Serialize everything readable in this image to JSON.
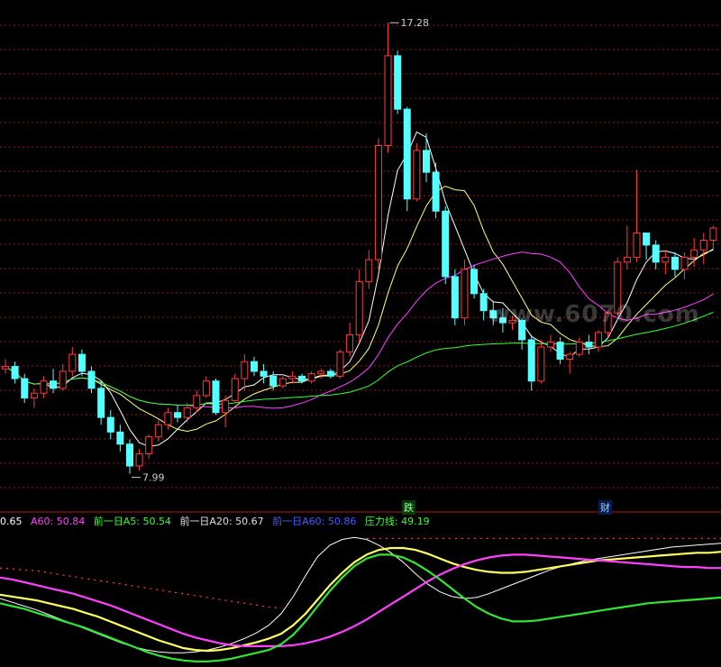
{
  "legend": {
    "a20_value": "0.65",
    "a60": "A60: 50.84",
    "prev_a5": "前一日A5: 50.54",
    "prev_a20": "前一日A20: 50.67",
    "prev_a60": "前一日A60: 50.86",
    "pressure": "压力线: 49.19"
  },
  "markers": {
    "die": "跌",
    "cai": "财"
  },
  "watermark": "www.6070.com",
  "colors": {
    "up": "#ff3b3b",
    "down": "#54ffff",
    "ma5": "#ffffff",
    "ma10": "#ffff80",
    "ma20": "#ff40ff",
    "ma60": "#33ff33",
    "grid": "#8a1a1a"
  },
  "chart_data": [
    {
      "type": "candlestick",
      "price_range": [
        7.5,
        17.6
      ],
      "annotations": [
        {
          "label": "17.28",
          "value": 17.28
        },
        {
          "label": "7.99",
          "value": 7.99
        }
      ],
      "candles": [
        [
          10.15,
          10.35,
          10.05,
          10.2
        ],
        [
          10.2,
          10.3,
          9.85,
          9.95
        ],
        [
          9.95,
          10.05,
          9.45,
          9.55
        ],
        [
          9.55,
          9.75,
          9.35,
          9.65
        ],
        [
          9.65,
          10.0,
          9.55,
          9.9
        ],
        [
          9.9,
          10.15,
          9.65,
          9.75
        ],
        [
          9.75,
          10.25,
          9.7,
          10.1
        ],
        [
          10.1,
          10.6,
          10.0,
          10.45
        ],
        [
          10.45,
          10.55,
          10.0,
          10.1
        ],
        [
          10.1,
          10.2,
          9.65,
          9.75
        ],
        [
          9.75,
          9.9,
          9.0,
          9.15
        ],
        [
          9.15,
          9.3,
          8.7,
          8.85
        ],
        [
          8.85,
          9.0,
          8.45,
          8.6
        ],
        [
          8.6,
          8.7,
          7.99,
          8.15
        ],
        [
          8.15,
          8.5,
          8.05,
          8.4
        ],
        [
          8.4,
          8.8,
          8.3,
          8.75
        ],
        [
          8.75,
          9.1,
          8.65,
          9.0
        ],
        [
          9.0,
          9.35,
          8.9,
          9.25
        ],
        [
          9.25,
          9.4,
          9.05,
          9.15
        ],
        [
          9.15,
          9.45,
          9.05,
          9.35
        ],
        [
          9.35,
          9.7,
          9.25,
          9.6
        ],
        [
          9.6,
          10.0,
          9.55,
          9.9
        ],
        [
          9.9,
          9.95,
          9.2,
          9.25
        ],
        [
          9.25,
          9.6,
          8.95,
          9.5
        ],
        [
          9.5,
          10.05,
          9.45,
          9.95
        ],
        [
          9.95,
          10.45,
          9.7,
          10.3
        ],
        [
          10.3,
          10.4,
          10.0,
          10.1
        ],
        [
          10.1,
          10.25,
          9.85,
          10.0
        ],
        [
          10.0,
          10.1,
          9.7,
          9.8
        ],
        [
          9.8,
          10.0,
          9.75,
          9.95
        ],
        [
          9.95,
          10.1,
          9.85,
          10.0
        ],
        [
          10.0,
          10.05,
          9.85,
          9.9
        ],
        [
          9.9,
          10.1,
          9.85,
          10.05
        ],
        [
          10.05,
          10.15,
          9.95,
          10.1
        ],
        [
          10.1,
          10.15,
          9.95,
          10.0
        ],
        [
          10.0,
          10.55,
          9.95,
          10.5
        ],
        [
          10.5,
          11.1,
          10.4,
          10.85
        ],
        [
          10.85,
          12.2,
          10.7,
          11.95
        ],
        [
          11.95,
          12.6,
          11.8,
          12.4
        ],
        [
          12.4,
          14.9,
          12.2,
          14.75
        ],
        [
          14.75,
          17.28,
          14.6,
          16.6
        ],
        [
          16.6,
          16.7,
          15.4,
          15.5
        ],
        [
          15.5,
          15.55,
          13.4,
          13.65
        ],
        [
          13.65,
          14.8,
          13.6,
          14.65
        ],
        [
          14.65,
          15.0,
          14.0,
          14.2
        ],
        [
          14.2,
          14.4,
          13.25,
          13.4
        ],
        [
          13.4,
          13.5,
          11.9,
          12.05
        ],
        [
          12.05,
          12.2,
          11.05,
          11.2
        ],
        [
          11.2,
          12.4,
          11.05,
          12.2
        ],
        [
          12.2,
          12.3,
          11.6,
          11.7
        ],
        [
          11.7,
          11.8,
          11.15,
          11.35
        ],
        [
          11.35,
          11.55,
          11.05,
          11.2
        ],
        [
          11.2,
          11.4,
          10.9,
          11.1
        ],
        [
          11.1,
          11.25,
          10.95,
          11.15
        ],
        [
          11.15,
          11.2,
          10.55,
          10.75
        ],
        [
          10.75,
          10.85,
          9.7,
          9.9
        ],
        [
          9.9,
          10.75,
          9.85,
          10.6
        ],
        [
          10.6,
          10.85,
          10.5,
          10.7
        ],
        [
          10.7,
          10.8,
          10.25,
          10.35
        ],
        [
          10.35,
          10.5,
          10.05,
          10.45
        ],
        [
          10.45,
          10.8,
          10.4,
          10.7
        ],
        [
          10.7,
          10.85,
          10.45,
          10.6
        ],
        [
          10.6,
          10.95,
          10.5,
          10.9
        ],
        [
          10.9,
          11.35,
          10.8,
          11.3
        ],
        [
          11.3,
          12.45,
          11.25,
          12.35
        ],
        [
          12.35,
          13.1,
          12.2,
          12.45
        ],
        [
          12.45,
          14.25,
          12.35,
          12.95
        ],
        [
          12.95,
          12.95,
          12.4,
          12.7
        ],
        [
          12.7,
          12.8,
          12.2,
          12.35
        ],
        [
          12.35,
          12.6,
          12.1,
          12.45
        ],
        [
          12.45,
          12.55,
          12.05,
          12.2
        ],
        [
          12.2,
          12.55,
          12.0,
          12.45
        ],
        [
          12.45,
          12.85,
          12.25,
          12.6
        ],
        [
          12.6,
          12.95,
          12.3,
          12.8
        ],
        [
          12.8,
          13.1,
          12.6,
          13.05
        ]
      ],
      "moving_averages": [
        {
          "period": 5,
          "color": "#ffffff"
        },
        {
          "period": 10,
          "color": "#ffff80"
        },
        {
          "period": 20,
          "color": "#ff40ff"
        },
        {
          "period": 60,
          "color": "#33ff33"
        }
      ]
    },
    {
      "type": "line",
      "y_range": [
        46,
        60
      ],
      "x_count": 60,
      "series": [
        {
          "color": "#ffffff",
          "values": [
            53.0,
            52.6,
            52.2,
            51.8,
            51.3,
            50.8,
            50.3,
            49.8,
            49.3,
            48.8,
            48.3,
            47.9,
            47.6,
            47.4,
            47.3,
            47.3,
            47.4,
            47.6,
            47.9,
            48.3,
            48.8,
            49.4,
            50.2,
            51.4,
            53.2,
            55.4,
            57.4,
            58.6,
            59.2,
            59.4,
            59.2,
            58.6,
            57.8,
            56.8,
            55.6,
            54.5,
            53.7,
            53.2,
            53.0,
            53.1,
            53.5,
            54.0,
            54.5,
            55.0,
            55.5,
            56.0,
            56.4,
            56.7,
            57.0,
            57.2,
            57.4,
            57.6,
            57.8,
            58.0,
            58.2,
            58.4,
            58.5,
            58.6,
            58.7,
            58.8
          ]
        },
        {
          "color": "#ffff60",
          "values": [
            53.4,
            53.2,
            53.0,
            52.8,
            52.5,
            52.2,
            51.9,
            51.5,
            51.1,
            50.6,
            50.1,
            49.6,
            49.1,
            48.6,
            48.2,
            47.8,
            47.6,
            47.5,
            47.6,
            47.8,
            48.1,
            48.4,
            48.8,
            49.3,
            50.2,
            51.4,
            52.9,
            54.4,
            55.7,
            56.8,
            57.6,
            58.1,
            58.3,
            58.3,
            58.1,
            57.7,
            57.2,
            56.7,
            56.3,
            56.0,
            55.8,
            55.7,
            55.7,
            55.8,
            56.0,
            56.2,
            56.4,
            56.6,
            56.8,
            57.0,
            57.1,
            57.2,
            57.3,
            57.4,
            57.5,
            57.6,
            57.7,
            57.8,
            57.8,
            57.9
          ]
        },
        {
          "color": "#ff40ff",
          "values": [
            55.2,
            55.0,
            54.7,
            54.4,
            54.1,
            53.8,
            53.5,
            53.1,
            52.7,
            52.3,
            51.8,
            51.3,
            50.8,
            50.3,
            49.8,
            49.3,
            48.9,
            48.6,
            48.3,
            48.1,
            48.0,
            48.0,
            48.0,
            48.0,
            48.1,
            48.3,
            48.6,
            49.0,
            49.5,
            50.1,
            50.8,
            51.6,
            52.4,
            53.2,
            54.0,
            54.8,
            55.5,
            56.1,
            56.6,
            57.0,
            57.3,
            57.5,
            57.6,
            57.6,
            57.5,
            57.4,
            57.3,
            57.2,
            57.1,
            57.0,
            56.9,
            56.8,
            56.7,
            56.6,
            56.5,
            56.4,
            56.3,
            56.3,
            56.2,
            56.2
          ]
        },
        {
          "color": "#33e633",
          "values": [
            52.5,
            52.2,
            51.9,
            51.5,
            51.1,
            50.7,
            50.3,
            49.9,
            49.4,
            48.9,
            48.4,
            47.9,
            47.4,
            47.0,
            46.7,
            46.5,
            46.4,
            46.4,
            46.5,
            46.7,
            47.0,
            47.3,
            47.6,
            48.2,
            49.2,
            50.6,
            52.2,
            53.8,
            55.2,
            56.4,
            57.2,
            57.6,
            57.6,
            57.3,
            56.7,
            55.9,
            55.0,
            54.0,
            53.0,
            52.1,
            51.4,
            50.9,
            50.6,
            50.6,
            50.7,
            50.9,
            51.1,
            51.3,
            51.5,
            51.7,
            51.9,
            52.1,
            52.3,
            52.5,
            52.6,
            52.7,
            52.8,
            52.9,
            53.0,
            53.1
          ]
        }
      ],
      "dashed_series": [
        {
          "color": "#ff3b3b",
          "values": [
            56.2,
            56.1,
            56.0,
            55.9,
            55.7,
            55.5,
            55.3,
            55.1,
            54.9,
            54.7,
            54.5,
            54.3,
            54.1,
            53.9,
            53.7,
            53.5,
            53.3,
            53.1,
            52.9,
            52.7,
            52.5,
            52.3,
            52.1,
            52.0,
            null,
            null,
            null,
            null,
            null,
            null,
            59.3,
            59.3,
            59.3,
            59.3,
            59.3,
            59.3,
            59.3,
            59.3,
            59.3,
            59.3,
            59.3,
            59.3,
            59.3,
            59.3,
            59.3,
            59.3,
            59.3,
            59.3,
            59.3,
            59.3,
            59.3,
            59.3,
            59.3,
            59.3,
            59.3,
            59.3,
            59.3,
            59.3,
            59.3,
            59.3
          ]
        }
      ]
    }
  ]
}
